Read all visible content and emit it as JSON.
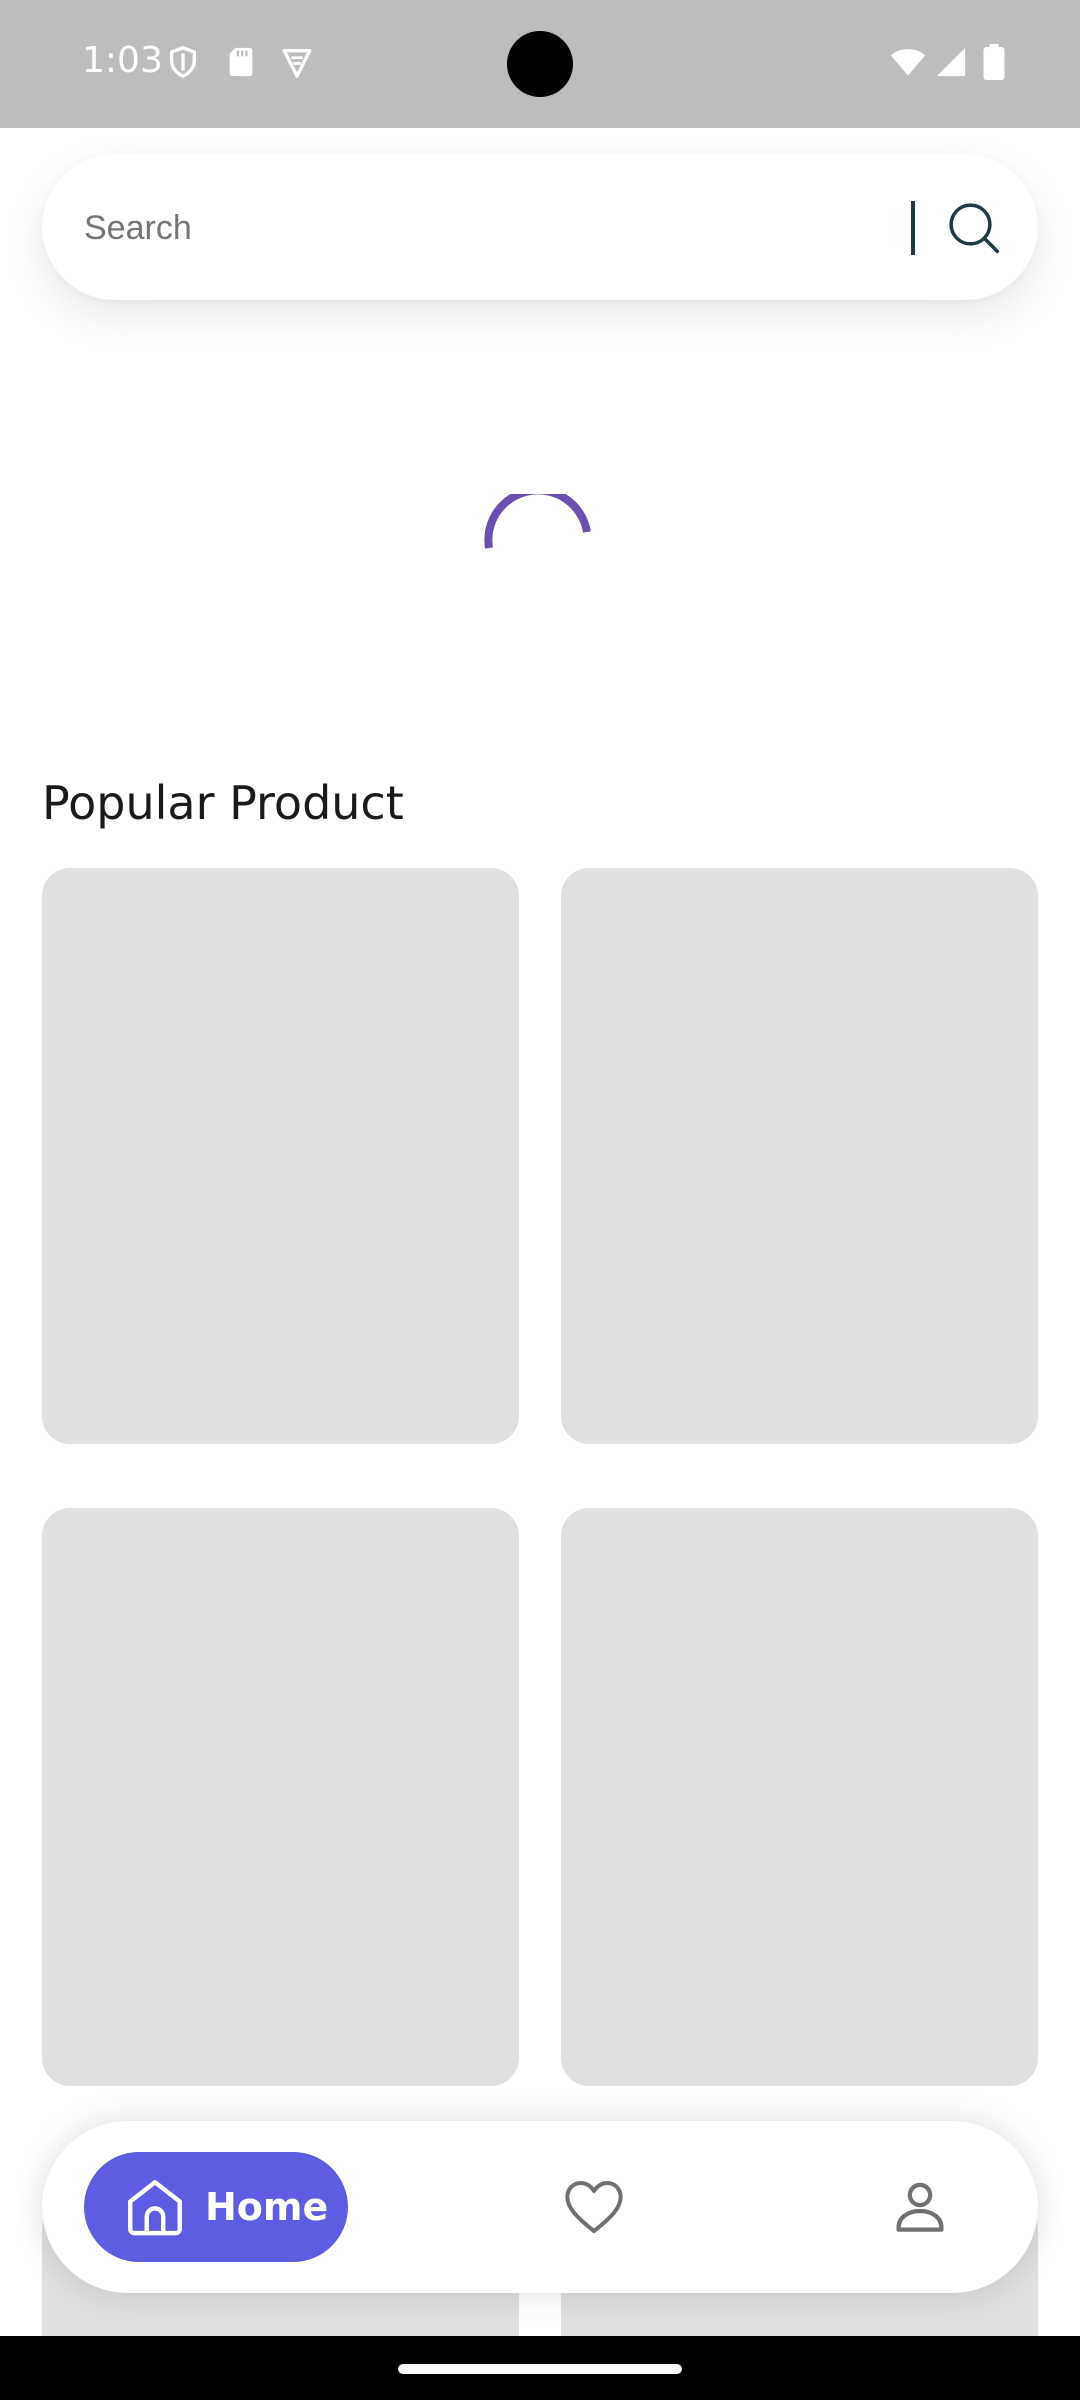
{
  "status_bar": {
    "time": "1:03",
    "icons": [
      "shield-icon",
      "sd-card-icon",
      "vpn-icon",
      "wifi-icon",
      "cell-signal-icon",
      "battery-icon"
    ]
  },
  "search": {
    "placeholder": "Search",
    "icon": "search-icon"
  },
  "loading": {
    "indicator": "loading-spinner",
    "color": "#6a4fb0"
  },
  "sections": {
    "popular_title": "Popular Product",
    "next_title": "",
    "placeholder_color": "#e0e0e0"
  },
  "bottom_nav": {
    "items": [
      {
        "label": "Home",
        "icon": "home-icon",
        "active": true
      },
      {
        "label": "",
        "icon": "heart-icon",
        "active": false
      },
      {
        "label": "",
        "icon": "profile-icon",
        "active": false
      }
    ],
    "accent": "#5e5ce0"
  }
}
